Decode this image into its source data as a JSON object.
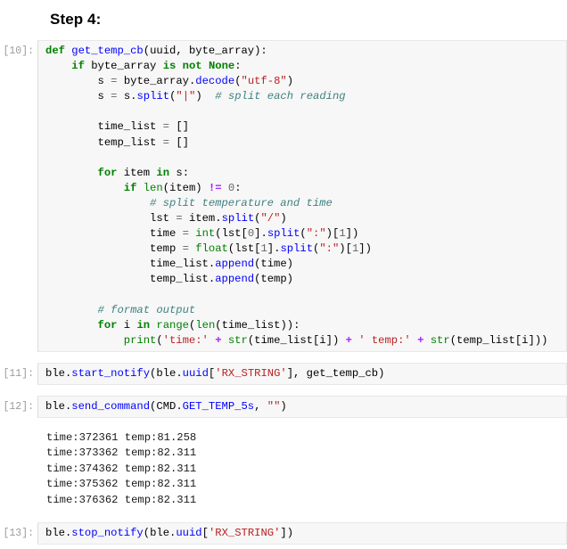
{
  "heading": {
    "text": "Step 4:"
  },
  "cells": [
    {
      "prompt": "[10]:",
      "kind": "code"
    },
    {
      "prompt": "[11]:",
      "kind": "code"
    },
    {
      "prompt": "[12]:",
      "kind": "code"
    },
    {
      "prompt": "[13]:",
      "kind": "code"
    }
  ],
  "cell10": {
    "prompt": "[10]:",
    "source": "def get_temp_cb(uuid, byte_array):\n    if byte_array is not None:\n        s = byte_array.decode(\"utf-8\")\n        s = s.split(\"|\")  # split each reading\n\n        time_list = []\n        temp_list = []\n\n        for item in s:\n            if len(item) != 0:\n                # split temperature and time\n                lst = item.split(\"/\")\n                time = int(lst[0].split(\":\")[1])\n                temp = float(lst[1].split(\":\")[1])\n                time_list.append(time)\n                temp_list.append(temp)\n\n        # format output\n        for i in range(len(time_list)):\n            print('time:' + str(time_list[i]) + ' temp:' + str(temp_list[i]))"
  },
  "cell11": {
    "prompt": "[11]:",
    "source": "ble.start_notify(ble.uuid['RX_STRING'], get_temp_cb)"
  },
  "cell12": {
    "prompt": "[12]:",
    "source": "ble.send_command(CMD.GET_TEMP_5s, \"\")",
    "output": "time:372361 temp:81.258\ntime:373362 temp:82.311\ntime:374362 temp:82.311\ntime:375362 temp:82.311\ntime:376362 temp:82.311",
    "output_rows": [
      {
        "time": "372361",
        "temp": "81.258"
      },
      {
        "time": "373362",
        "temp": "82.311"
      },
      {
        "time": "374362",
        "temp": "82.311"
      },
      {
        "time": "375362",
        "temp": "82.311"
      },
      {
        "time": "376362",
        "temp": "82.311"
      }
    ]
  },
  "cell13": {
    "prompt": "[13]:",
    "source": "ble.stop_notify(ble.uuid['RX_STRING'])"
  },
  "colors": {
    "cell_background": "#f7f7f7",
    "cell_border": "#e8e8e8",
    "prompt_text": "#9c9c9c",
    "keyword": "#008000",
    "function_name": "#0000ff",
    "builtin": "#008000",
    "string": "#ba2121",
    "comment": "#408080",
    "operator": "#666666",
    "special_operator": "#aa22ff",
    "number": "#666666",
    "page_background": "#ffffff"
  }
}
